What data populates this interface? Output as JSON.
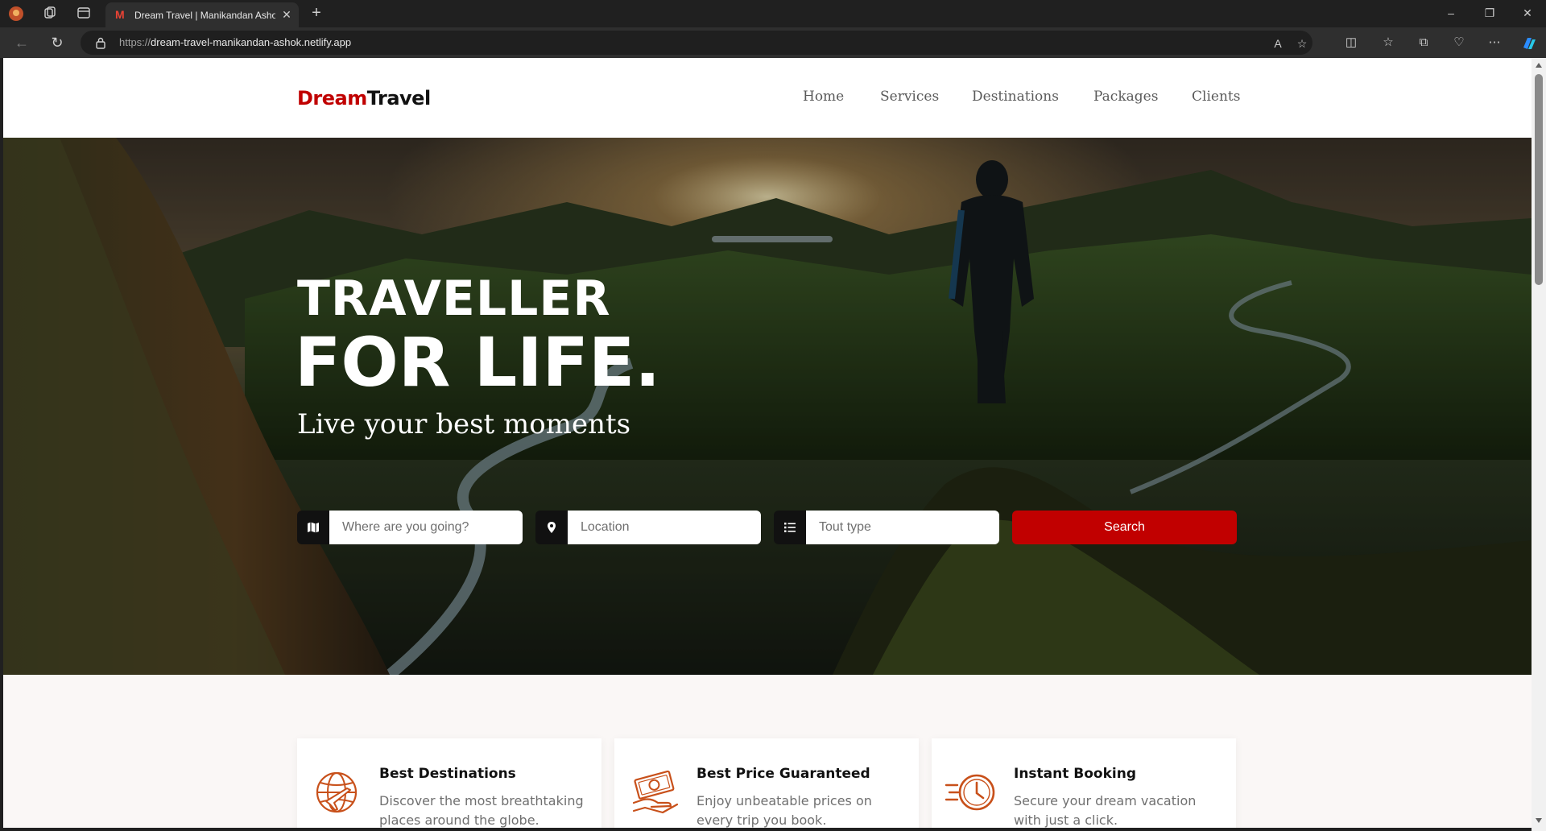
{
  "browser": {
    "tab_title": "Dream Travel | Manikandan Ashok",
    "url_scheme": "https://",
    "url_host": "dream-travel-manikandan-ashok.netlify.app"
  },
  "site": {
    "logo_part1": "Dream",
    "logo_part2": "Travel",
    "nav": [
      "Home",
      "Services",
      "Destinations",
      "Packages",
      "Clients"
    ]
  },
  "hero": {
    "line1": "TRAVELLER",
    "line2": "FOR LIFE.",
    "tagline": "Live your best moments",
    "search": {
      "destination_placeholder": "Where are you going?",
      "location_placeholder": "Location",
      "tour_placeholder": "Tout type",
      "button_label": "Search"
    }
  },
  "features": [
    {
      "title": "Best Destinations",
      "desc": "Discover the most breathtaking places around the globe.",
      "icon": "globe-plane-icon"
    },
    {
      "title": "Best Price Guaranteed",
      "desc": "Enjoy unbeatable prices on every trip you book.",
      "icon": "money-hand-icon"
    },
    {
      "title": "Instant Booking",
      "desc": "Secure your dream vacation with just a click.",
      "icon": "fast-clock-icon"
    }
  ],
  "colors": {
    "brand_red": "#c10000",
    "accent_orange": "#c8501a"
  }
}
